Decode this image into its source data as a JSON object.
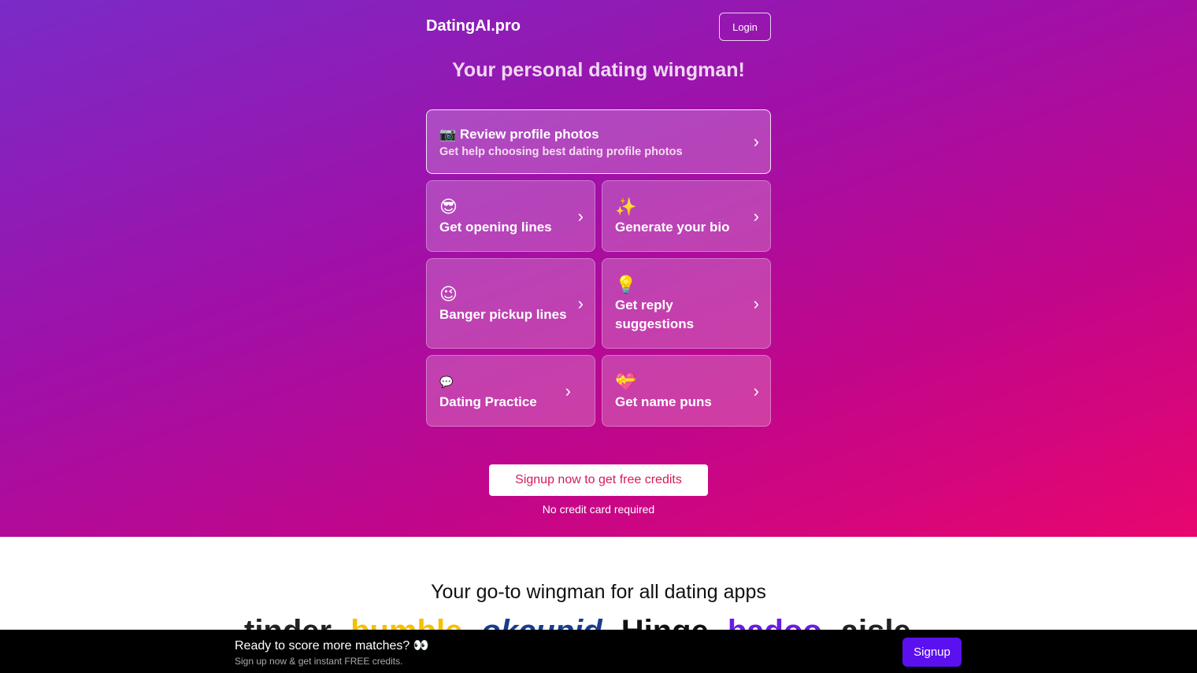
{
  "header": {
    "logo": "DatingAI.pro",
    "login": "Login"
  },
  "tagline": "Your personal dating wingman!",
  "cards": [
    {
      "emoji": "📷",
      "title": "Review profile photos",
      "subtitle": "Get help choosing best dating profile photos"
    },
    {
      "emoji": "😎",
      "title": "Get opening lines"
    },
    {
      "emoji": "✨",
      "title": "Generate your bio"
    },
    {
      "emoji": "😉",
      "title": "Banger pickup lines"
    },
    {
      "emoji": "💡",
      "title": "Get reply suggestions"
    },
    {
      "emoji": "💬",
      "title": "Dating Practice"
    },
    {
      "emoji": "💝",
      "title": "Get name puns"
    }
  ],
  "chevron": "›",
  "cta": {
    "button": "Signup now to get free credits",
    "note": "No credit card required"
  },
  "apps": {
    "title": "Your go-to wingman for all dating apps",
    "logos": [
      {
        "name": "tinder",
        "color": "#222"
      },
      {
        "name": "bumble",
        "color": "#f5c000"
      },
      {
        "name": "okcupid",
        "color": "#1a3c8c"
      },
      {
        "name": "Hinge",
        "color": "#111"
      },
      {
        "name": "badoo",
        "color": "#6a1be0"
      },
      {
        "name": "aisle",
        "color": "#222"
      }
    ]
  },
  "banner": {
    "headline": "Ready to score more matches? 👀",
    "sub": "Sign up now & get instant FREE credits.",
    "button": "Signup"
  }
}
